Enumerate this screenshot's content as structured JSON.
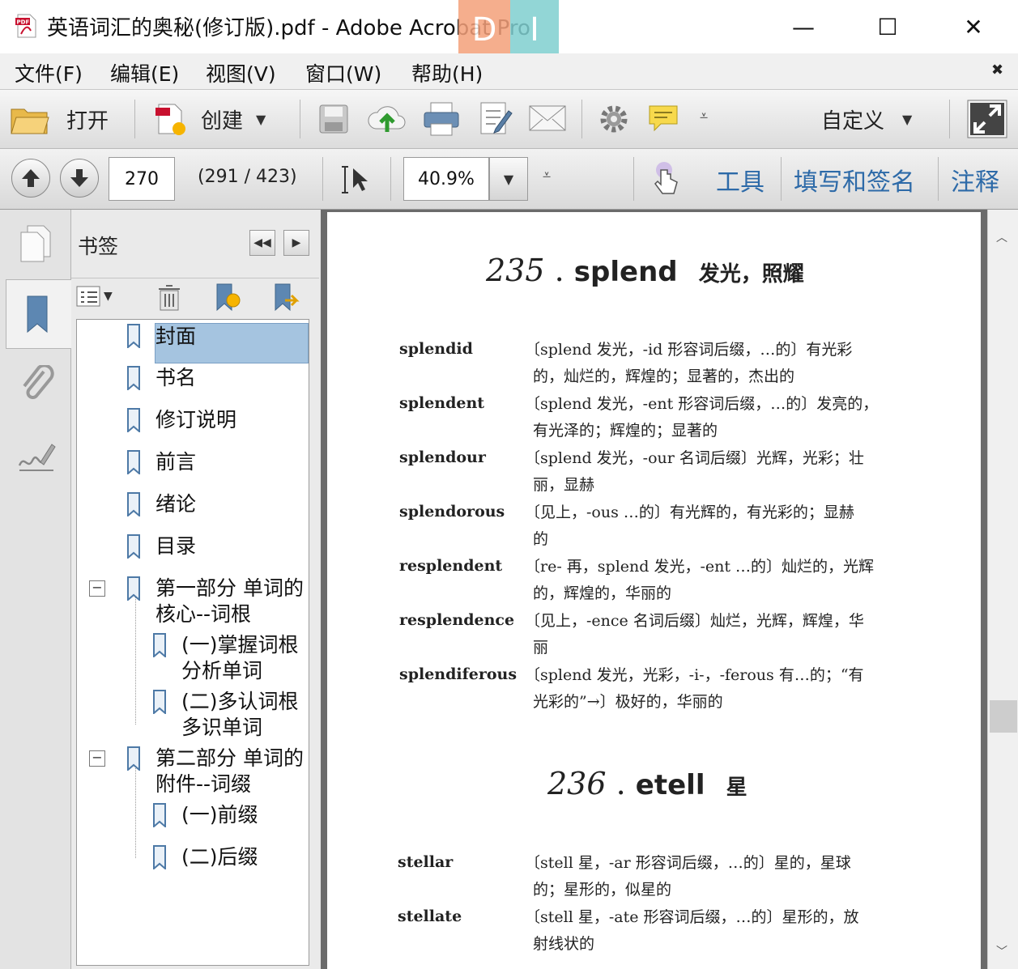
{
  "window": {
    "title": "英语词汇的奥秘(修订版).pdf - Adobe Acrobat Pro",
    "badges": [
      "D",
      "I"
    ],
    "controls": [
      "—",
      "☐",
      "✕"
    ]
  },
  "menu": {
    "items": [
      "文件(F)",
      "编辑(E)",
      "视图(V)",
      "窗口(W)",
      "帮助(H)"
    ],
    "close_glyph": "✖"
  },
  "toolbar": {
    "open_label": "打开",
    "create_label": "创建",
    "customize_label": "自定义"
  },
  "navbar": {
    "page_number": "270",
    "page_info": "(291 / 423)",
    "zoom": "40.9%",
    "tools_label": "工具",
    "fill_sign_label": "填写和签名",
    "comment_label": "注释"
  },
  "bookmarks": {
    "title": "书签",
    "items": [
      {
        "label": "封面",
        "level": 0,
        "selected": true
      },
      {
        "label": "书名",
        "level": 0
      },
      {
        "label": "修订说明",
        "level": 0
      },
      {
        "label": "前言",
        "level": 0
      },
      {
        "label": "绪论",
        "level": 0
      },
      {
        "label": "目录",
        "level": 0
      },
      {
        "label_line1": "第一部分 单词的",
        "label_line2": "核心--词根",
        "level": 0,
        "expanded": true
      },
      {
        "label_line1": "(一)掌握词根",
        "label_line2": "分析单词",
        "level": 1
      },
      {
        "label_line1": "(二)多认词根",
        "label_line2": "多识单词",
        "level": 1
      },
      {
        "label_line1": "第二部分 单词的",
        "label_line2": "附件--词缀",
        "level": 0,
        "expanded": true
      },
      {
        "label": "(一)前缀",
        "level": 1
      },
      {
        "label": "(二)后缀",
        "level": 1
      }
    ]
  },
  "document": {
    "sections": [
      {
        "number": "235",
        "root": "splend",
        "meaning": "发光，照耀",
        "entries": [
          {
            "word": "splendid",
            "def_line1": "〔splend 发光，-id 形容词后缀，…的〕有光彩",
            "def_line2": "的，灿烂的，辉煌的；显著的，杰出的"
          },
          {
            "word": "splendent",
            "def_line1": "〔splend 发光，-ent 形容词后缀，…的〕发亮的，",
            "def_line2": "有光泽的；辉煌的；显著的"
          },
          {
            "word": "splendour",
            "def_line1": "〔splend 发光，-our 名词后缀〕光辉，光彩；壮",
            "def_line2": "丽，显赫"
          },
          {
            "word": "splendorous",
            "def_line1": "〔见上，-ous …的〕有光辉的，有光彩的；显赫",
            "def_line2": "的"
          },
          {
            "word": "resplendent",
            "def_line1": "〔re- 再，splend 发光，-ent …的〕灿烂的，光辉",
            "def_line2": "的，辉煌的，华丽的"
          },
          {
            "word": "resplendence",
            "def_line1": "〔见上，-ence 名词后缀〕灿烂，光辉，辉煌，华",
            "def_line2": "丽"
          },
          {
            "word": "splendiferous",
            "def_line1": "〔splend 发光，光彩，-i-，-ferous 有…的；“有",
            "def_line2": "光彩的”→〕极好的，华丽的"
          }
        ]
      },
      {
        "number": "236",
        "root": "etell",
        "meaning": "星",
        "entries": [
          {
            "word": "stellar",
            "def_line1": "〔stell 星，-ar 形容词后缀，…的〕星的，星球",
            "def_line2": "的；星形的，似星的"
          },
          {
            "word": "stellate",
            "def_line1": "〔stell 星，-ate 形容词后缀，…的〕星形的，放",
            "def_line2": "射线状的"
          }
        ]
      }
    ]
  },
  "colors": {
    "link_blue": "#2d6aa8",
    "selection": "#a5c4e0",
    "badge_orange": "#f4a07a",
    "badge_teal": "#7fcfd0"
  }
}
